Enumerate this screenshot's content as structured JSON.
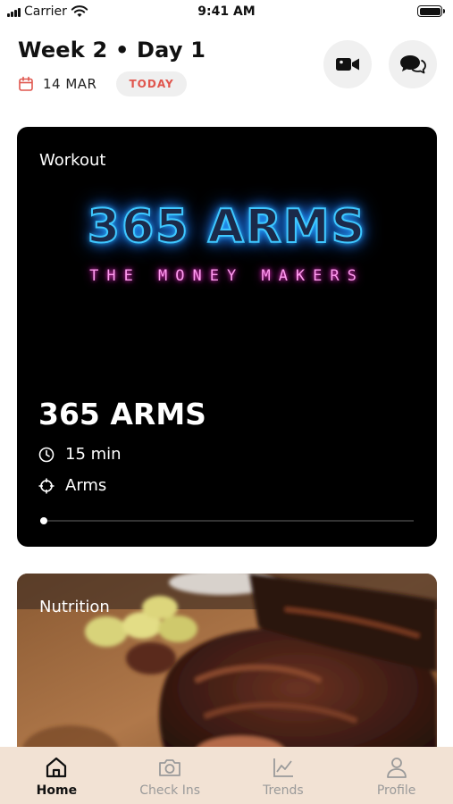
{
  "status_bar": {
    "carrier": "Carrier",
    "time": "9:41 AM"
  },
  "header": {
    "title": "Week 2 • Day 1",
    "date": "14 MAR",
    "today_label": "TODAY"
  },
  "workout_card": {
    "label": "Workout",
    "banner_title": "365 ARMS",
    "banner_subtitle": "THE MONEY MAKERS",
    "name": "365 ARMS",
    "duration": "15 min",
    "target": "Arms",
    "progress_fraction": 0.01,
    "neon_title_color": "#3ec7ff",
    "neon_subtitle_color": "#ff3fd8"
  },
  "nutrition_card": {
    "label": "Nutrition"
  },
  "tab_bar": {
    "background": "#f2e2d4",
    "tabs": [
      {
        "label": "Home",
        "icon": "home-icon",
        "active": true
      },
      {
        "label": "Check Ins",
        "icon": "camera-icon",
        "active": false
      },
      {
        "label": "Trends",
        "icon": "chart-icon",
        "active": false
      },
      {
        "label": "Profile",
        "icon": "person-icon",
        "active": false
      }
    ]
  }
}
